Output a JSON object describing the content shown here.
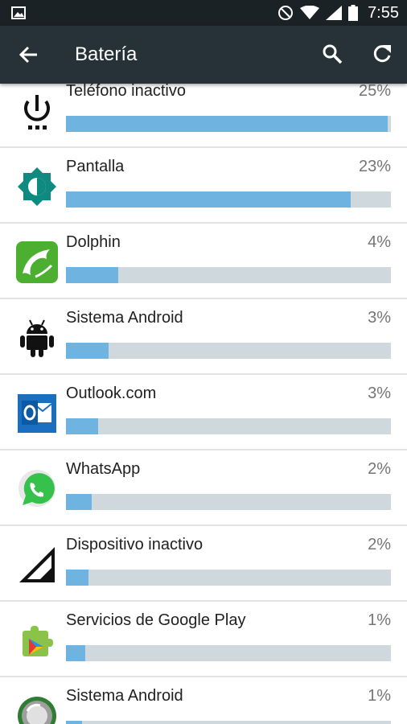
{
  "status_bar": {
    "time": "7:55",
    "icons": [
      "image-icon",
      "do-not-disturb-icon",
      "wifi-icon",
      "signal-icon",
      "battery-icon"
    ]
  },
  "app_bar": {
    "title": "Batería",
    "icons": [
      "back-arrow-icon",
      "search-icon",
      "refresh-icon"
    ],
    "color": "#263238"
  },
  "usage_items": [
    {
      "label": "Teléfono inactivo",
      "percent": "25%",
      "level": 0.99,
      "icon": "power-icon"
    },
    {
      "label": "Pantalla",
      "percent": "23%",
      "level": 0.877,
      "icon": "brightness-icon"
    },
    {
      "label": "Dolphin",
      "percent": "4%",
      "level": 0.16,
      "icon": "dolphin-app-icon"
    },
    {
      "label": "Sistema Android",
      "percent": "3%",
      "level": 0.13,
      "icon": "android-icon"
    },
    {
      "label": "Outlook.com",
      "percent": "3%",
      "level": 0.1,
      "icon": "outlook-app-icon"
    },
    {
      "label": "WhatsApp",
      "percent": "2%",
      "level": 0.08,
      "icon": "whatsapp-app-icon"
    },
    {
      "label": "Dispositivo inactivo",
      "percent": "2%",
      "level": 0.07,
      "icon": "cell-signal-icon"
    },
    {
      "label": "Servicios de Google Play",
      "percent": "1%",
      "level": 0.06,
      "icon": "google-play-services-icon"
    },
    {
      "label": "Sistema Android",
      "percent": "1%",
      "level": 0.05,
      "icon": "android-system-app-icon"
    }
  ],
  "colors": {
    "bar_fill": "#6fb3e0",
    "bar_track": "#cfd8dc"
  }
}
